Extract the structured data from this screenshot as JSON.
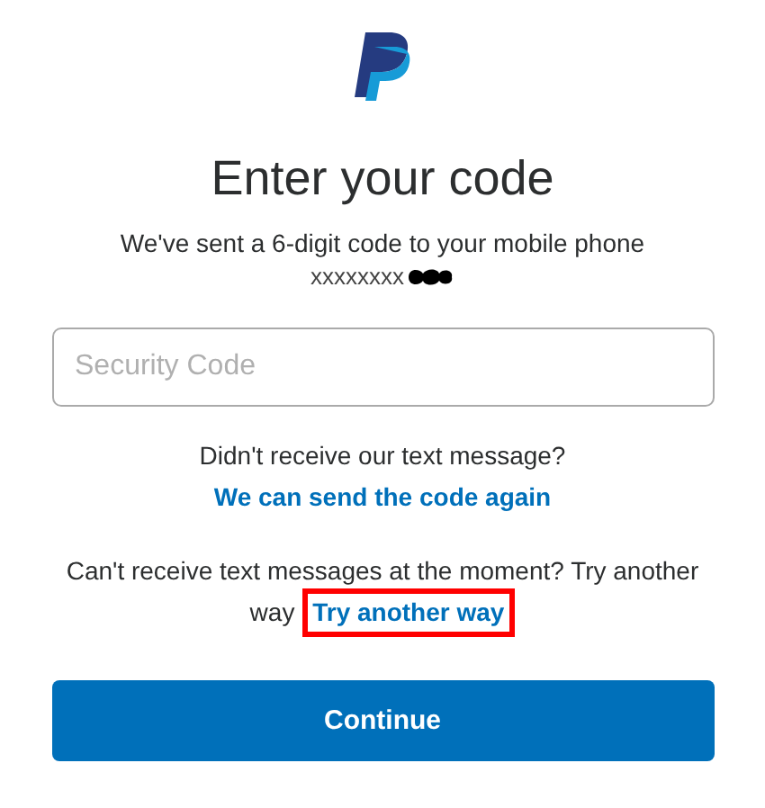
{
  "title": "Enter your code",
  "message": "We've sent a 6-digit code to your mobile phone",
  "phone": "xxxxxxxx",
  "security_code": {
    "placeholder": "Security Code"
  },
  "resend": {
    "text": "Didn't receive our text message?",
    "link": "We can send the code again",
    "highlighted": false
  },
  "alternative": {
    "text": "Can't receive text messages at the moment? Try another way",
    "link": "Try another way",
    "highlighted": true
  },
  "buttons": [
    "Continue"
  ]
}
